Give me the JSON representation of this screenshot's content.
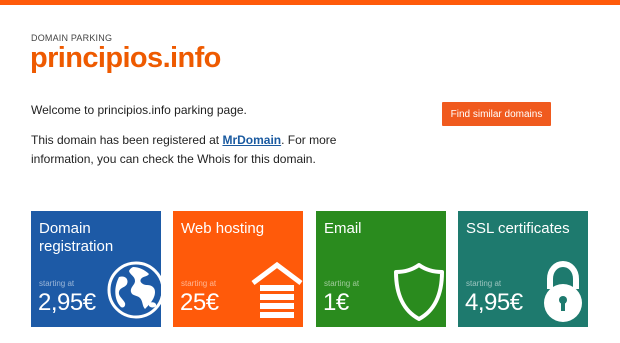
{
  "header": {
    "kicker": "DOMAIN PARKING",
    "domain": "principios.info"
  },
  "content": {
    "welcome": "Welcome to principios.info parking page.",
    "info_before": "This domain has been registered at ",
    "registrar_link": "MrDomain",
    "info_after": ". For more information, you can check the Whois for this domain."
  },
  "actions": {
    "find_similar_label": "Find similar domains"
  },
  "tiles": [
    {
      "title": "Domain registration",
      "starting_label": "starting at",
      "price": "2,95€",
      "icon": "globe-icon",
      "color": "#1d5aa6"
    },
    {
      "title": "Web hosting",
      "starting_label": "starting at",
      "price": "25€",
      "icon": "house-icon",
      "color": "#ff5a0a"
    },
    {
      "title": "Email",
      "starting_label": "starting at",
      "price": "1€",
      "icon": "shield-icon",
      "color": "#2a8b1e"
    },
    {
      "title": "SSL certificates",
      "starting_label": "starting at",
      "price": "4,95€",
      "icon": "padlock-icon",
      "color": "#1e7a6e"
    }
  ],
  "colors": {
    "accent": "#ff5a0a",
    "link": "#1a5aa0"
  }
}
